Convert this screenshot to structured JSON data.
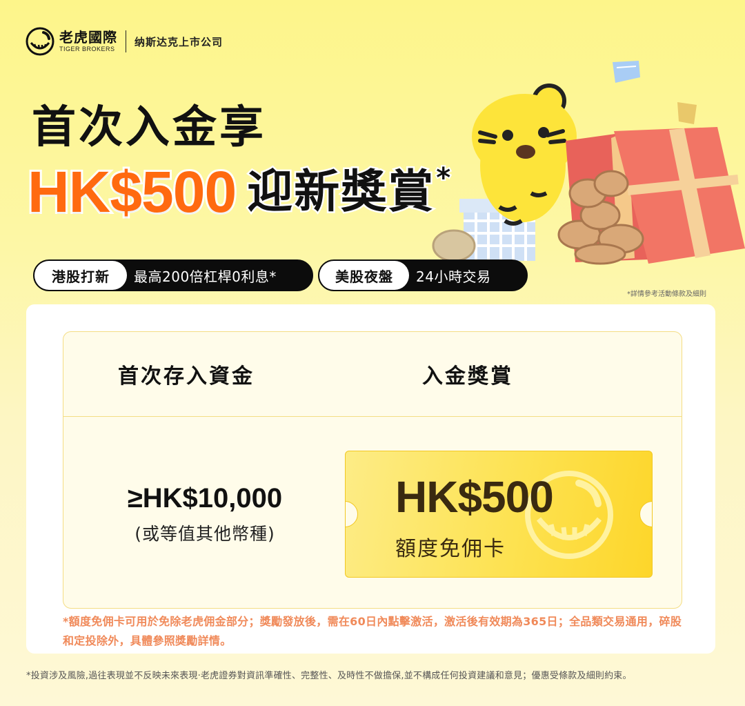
{
  "brand": {
    "name_cn": "老虎國際",
    "name_en": "TIGER BROKERS",
    "tagline": "纳斯达克上市公司"
  },
  "headline": {
    "line1": "首次入金享",
    "amount": "HK$500",
    "rest": "迎新獎賞",
    "star": "*"
  },
  "pills": [
    {
      "label": "港股打新",
      "value": "最高200倍杠桿0利息*"
    },
    {
      "label": "美股夜盤",
      "value": "24小時交易"
    }
  ],
  "terms_note": "*詳情參考活動條款及細則",
  "table": {
    "header_left": "首次存入資金",
    "header_right": "入金獎賞",
    "deposit_value": "≥HK$10,000",
    "deposit_note": "(或等值其他幣種)",
    "reward_amount": "HK$500",
    "reward_label": "額度免佣卡"
  },
  "card_disclaimer": "*額度免佣卡可用於免除老虎佣金部分；獎勵發放後，需在60日內點擊激活，激活後有效期為365日；全品類交易通用，碎股和定投除外，具體參照獎勵詳情。",
  "footer_disclaimer": "*投資涉及風險,過往表現並不反映未來表現·老虎證券對資訊準確性、完整性、及時性不做擔保,並不構成任何投資建議和意見；優惠受條款及細則約束。",
  "colors": {
    "accent_orange": "#ff6a10",
    "ticket_yellow": "#fde251",
    "disclaimer_orange": "#f08a5a"
  }
}
